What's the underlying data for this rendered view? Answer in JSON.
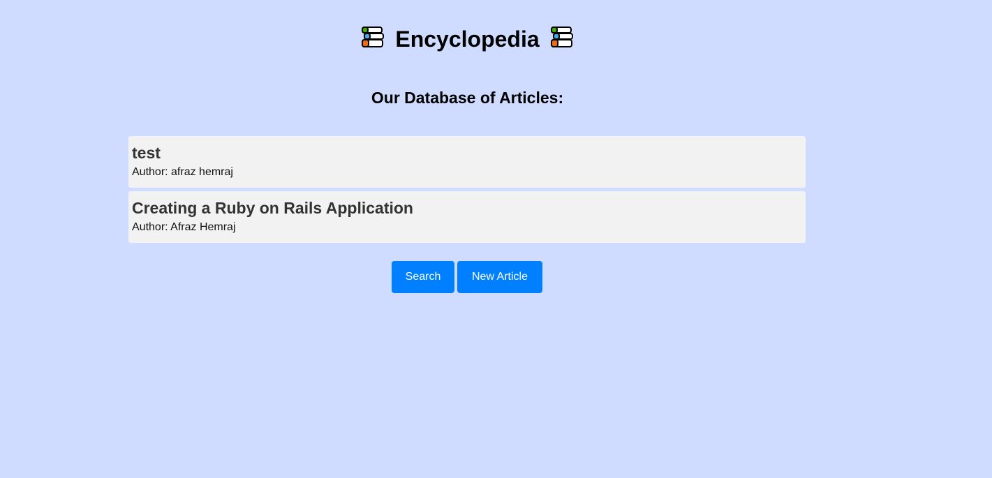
{
  "header": {
    "title": "Encyclopedia",
    "left_icon": "books-icon",
    "right_icon": "books-icon"
  },
  "subtitle": "Our Database of Articles:",
  "articles": [
    {
      "title": "test",
      "author": "Author: afraz hemraj"
    },
    {
      "title": "Creating a Ruby on Rails Application",
      "author": "Author: Afraz Hemraj"
    }
  ],
  "buttons": {
    "search_label": "Search",
    "new_article_label": "New Article"
  },
  "colors": {
    "background": "#d0dcff",
    "card": "#f2f2f2",
    "button": "#0080ff"
  }
}
